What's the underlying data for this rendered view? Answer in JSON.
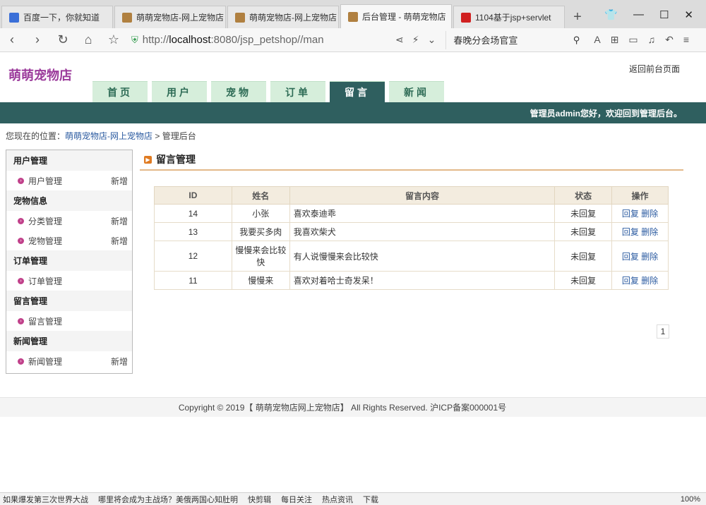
{
  "browser": {
    "tabs": [
      {
        "label": "百度一下，你就知道",
        "color": "#3a6fd8",
        "active": false
      },
      {
        "label": "萌萌宠物店-网上宠物店",
        "color": "#b08040",
        "active": false
      },
      {
        "label": "萌萌宠物店-网上宠物店",
        "color": "#b08040",
        "active": false
      },
      {
        "label": "后台管理 - 萌萌宠物店",
        "color": "#b08040",
        "active": true
      },
      {
        "label": "1104基于jsp+servlet",
        "color": "#d02020",
        "active": false
      }
    ],
    "url_prefix": "http://",
    "url_host": "localhost",
    "url_rest": ":8080/jsp_petshop//man",
    "search_text": "春晚分会场官宣"
  },
  "site": {
    "logo": "萌萌宠物店",
    "back_link": "返回前台页面",
    "nav": [
      {
        "label": "首页",
        "active": false
      },
      {
        "label": "用户",
        "active": false
      },
      {
        "label": "宠物",
        "active": false
      },
      {
        "label": "订单",
        "active": false
      },
      {
        "label": "留言",
        "active": true
      },
      {
        "label": "新闻",
        "active": false
      }
    ],
    "welcome": "管理员admin您好，欢迎回到管理后台。",
    "crumb_prefix": "您现在的位置：",
    "crumb_home": "萌萌宠物店-网上宠物店",
    "crumb_sep": " > ",
    "crumb_current": "管理后台"
  },
  "sidebar": {
    "groups": [
      {
        "title": "用户管理",
        "items": [
          {
            "label": "用户管理",
            "add": "新增"
          }
        ]
      },
      {
        "title": "宠物信息",
        "items": [
          {
            "label": "分类管理",
            "add": "新增"
          },
          {
            "label": "宠物管理",
            "add": "新增"
          }
        ]
      },
      {
        "title": "订单管理",
        "items": [
          {
            "label": "订单管理",
            "add": ""
          }
        ]
      },
      {
        "title": "留言管理",
        "items": [
          {
            "label": "留言管理",
            "add": ""
          }
        ]
      },
      {
        "title": "新闻管理",
        "items": [
          {
            "label": "新闻管理",
            "add": "新增"
          }
        ]
      }
    ]
  },
  "main": {
    "title": "留言管理",
    "columns": [
      "ID",
      "姓名",
      "留言内容",
      "状态",
      "操作"
    ],
    "rows": [
      {
        "id": "14",
        "name": "小张",
        "content": "喜欢泰迪乖",
        "status": "未回复",
        "reply": "回复",
        "delete": "删除"
      },
      {
        "id": "13",
        "name": "我要买多肉",
        "content": "我喜欢柴犬",
        "status": "未回复",
        "reply": "回复",
        "delete": "删除"
      },
      {
        "id": "12",
        "name": "慢慢来会比较快",
        "content": "有人说慢慢来会比较快",
        "status": "未回复",
        "reply": "回复",
        "delete": "删除"
      },
      {
        "id": "11",
        "name": "慢慢来",
        "content": "喜欢对着哈士奇发呆！",
        "status": "未回复",
        "reply": "回复",
        "delete": "删除"
      }
    ],
    "page": "1"
  },
  "footer": "Copyright © 2019【 萌萌宠物店网上宠物店】 All Rights Reserved. 沪ICP备案000001号",
  "statusbar": {
    "items": [
      "如果爆发第三次世界大战",
      "哪里将会成为主战场？美俄两国心知肚明",
      "快剪辑",
      "每日关注",
      "热点资讯",
      "下载"
    ],
    "zoom": "100%"
  }
}
